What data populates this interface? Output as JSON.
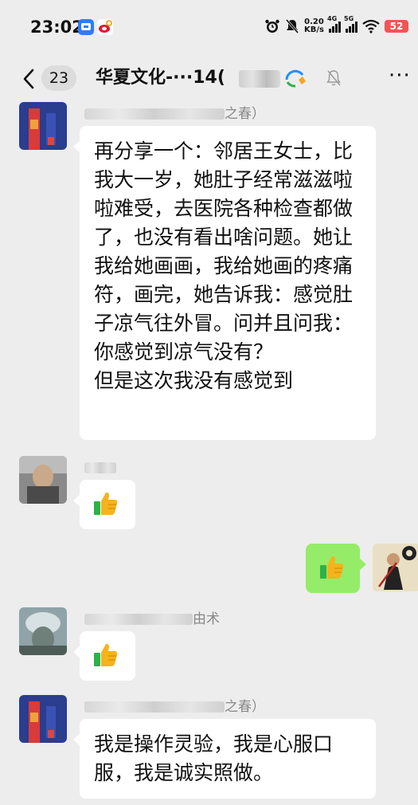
{
  "status_bar": {
    "time": "23:02",
    "net_speed_value": "0.20",
    "net_speed_unit": "KB/s",
    "signal_1_label": "4G",
    "signal_2_label": "5G",
    "battery": "52",
    "icons": [
      "alarm-icon",
      "mute-bell-icon",
      "wifi-icon"
    ]
  },
  "nav": {
    "back_label": "<",
    "unread_count": "23",
    "title": "华夏文化-···14(",
    "mute_icon": "bell-off-icon",
    "more": "···"
  },
  "messages": [
    {
      "side": "left",
      "sender_suffix": "之春）",
      "text": "再分享一个：邻居王女士，比我大一岁，她肚子经常滋滋啦啦难受，去医院各种检查都做了，也没有看出啥问题。她让我给她画画，我给她画的疼痛符，画完，她告诉我：感觉肚子凉气往外冒。问并且问我：你感觉到凉气没有？\n但是这次我没有感觉到"
    },
    {
      "side": "left",
      "sender_suffix": "",
      "text": "",
      "emoji": "thumbs-up"
    },
    {
      "side": "right",
      "text": "",
      "emoji": "thumbs-up"
    },
    {
      "side": "left",
      "sender_suffix": "由术",
      "text": "",
      "emoji": "thumbs-up"
    },
    {
      "side": "left",
      "sender_suffix": "之春）",
      "text": "我是操作灵验，我是心服口服，我是诚实照做。"
    }
  ],
  "colors": {
    "background": "#ededed",
    "bubble_left": "#ffffff",
    "bubble_right": "#95ec69",
    "thumb_yellow": "#f5b31c",
    "thumb_green": "#2db14a"
  }
}
